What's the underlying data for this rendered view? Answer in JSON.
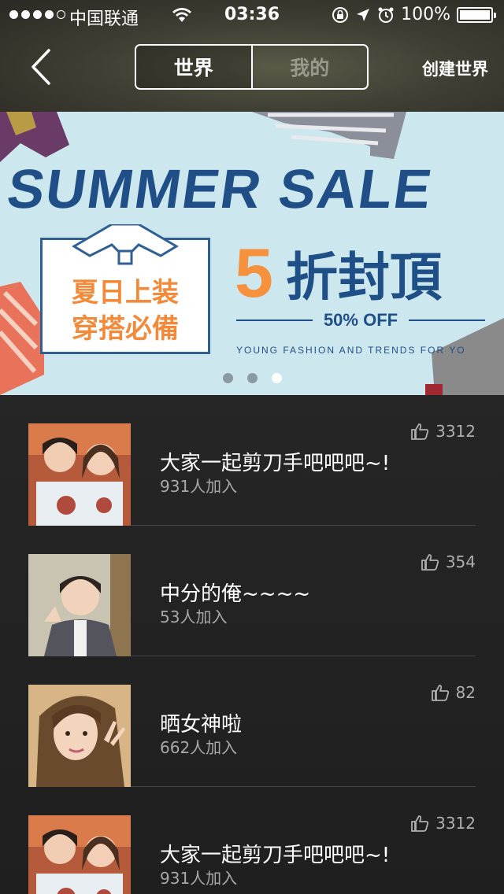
{
  "status_bar": {
    "carrier": "中国联通",
    "time": "03:36",
    "battery": "100%"
  },
  "header": {
    "tabs": [
      {
        "label": "世界",
        "active": true
      },
      {
        "label": "我的",
        "active": false
      }
    ],
    "create_label": "创建世界"
  },
  "banner": {
    "title": "SUMMER SALE",
    "box_line1": "夏日上装",
    "box_line2": "穿搭必備",
    "discount_number": "5",
    "discount_text": "折封頂",
    "percent_off": "50% OFF",
    "tagline": "YOUNG FASHION AND TRENDS FOR YO",
    "dot_count": 3,
    "active_dot": 2
  },
  "worlds": [
    {
      "title": "大家一起剪刀手吧吧吧~!",
      "members": "931人加入",
      "likes": "3312"
    },
    {
      "title": "中分的俺~~~~",
      "members": "53人加入",
      "likes": "354"
    },
    {
      "title": "晒女神啦",
      "members": "662人加入",
      "likes": "82"
    },
    {
      "title": "大家一起剪刀手吧吧吧~!",
      "members": "931人加入",
      "likes": "3312"
    }
  ],
  "colors": {
    "banner_blue": "#1f4f86",
    "banner_orange": "#f6913d",
    "banner_bg": "#cde7ef"
  }
}
